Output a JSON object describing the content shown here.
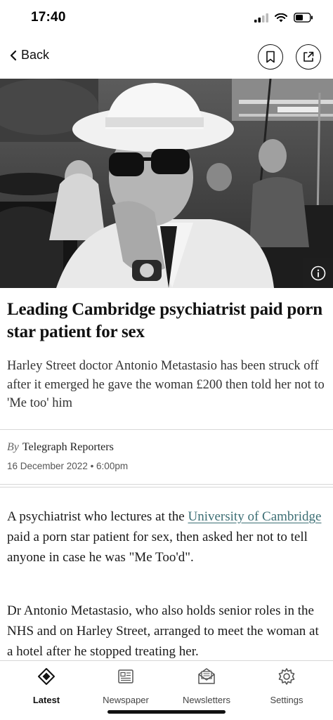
{
  "status_bar": {
    "time": "17:40"
  },
  "nav": {
    "back_label": "Back"
  },
  "hero": {
    "description_icon": "info-icon"
  },
  "article": {
    "headline": "Leading Cambridge psychiatrist paid porn star patient for sex",
    "standfirst": "Harley Street doctor Antonio Metastasio has been struck off after it emerged he gave the woman £200 then told her not to 'Me too' him",
    "byline_prefix": "By",
    "author": "Telegraph Reporters",
    "date": "16 December 2022 • 6:00pm",
    "p1_before": "A psychiatrist who lectures at the ",
    "p1_link": "University of Cambridge",
    "p1_after": " paid a porn star patient for sex, then asked her not to tell anyone in case he was \"Me Too'd\".",
    "p2": "Dr Antonio Metastasio, who also holds senior roles in the NHS and on Harley Street, arranged to meet the woman at a hotel after he stopped treating her."
  },
  "tabs": [
    {
      "label": "Latest",
      "icon": "diamond-icon",
      "active": true
    },
    {
      "label": "Newspaper",
      "icon": "newspaper-icon",
      "active": false
    },
    {
      "label": "Newsletters",
      "icon": "envelope-icon",
      "active": false
    },
    {
      "label": "Settings",
      "icon": "gear-icon",
      "active": false
    }
  ],
  "colors": {
    "link": "#3c6e74",
    "text": "#1a1a1a",
    "divider": "#d8d8d8"
  }
}
